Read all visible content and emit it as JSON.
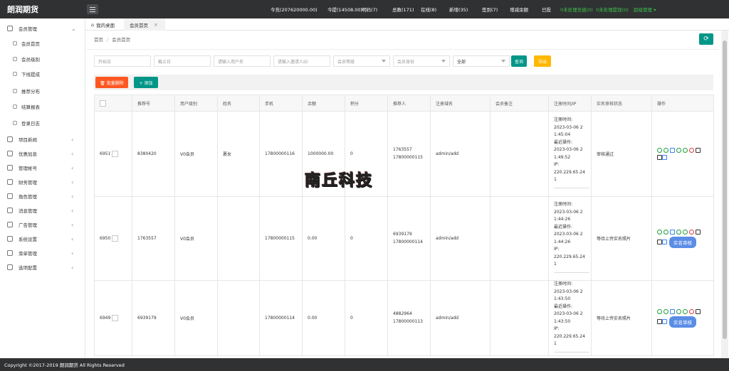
{
  "brand": "朗润期货",
  "topbar": {
    "stats": [
      {
        "label": "今充(207620000.00)",
        "color": "white"
      },
      {
        "label": "今提(14508.00)",
        "color": "white"
      },
      {
        "label": "明码(7)",
        "color": "white"
      },
      {
        "label": "总数(171)",
        "color": "white"
      },
      {
        "label": "在线(8)",
        "color": "white"
      },
      {
        "label": "新增(35)",
        "color": "white"
      },
      {
        "label": "签到(7)",
        "color": "white"
      },
      {
        "label": "增减余额",
        "color": "white"
      },
      {
        "label": "已投",
        "color": "white"
      },
      {
        "label": "0未处理充值(0)",
        "color": "green"
      },
      {
        "label": "0未处理提现(0)",
        "color": "green"
      },
      {
        "label": "超级管理 ▾",
        "color": "green"
      }
    ]
  },
  "sidebar": {
    "items": [
      {
        "label": "会员管理",
        "expanded": true
      },
      {
        "label": "会员首页",
        "sub": true
      },
      {
        "label": "会员级别",
        "sub": true
      },
      {
        "label": "下线提成",
        "sub": true
      },
      {
        "label": "推荐分布",
        "sub": true
      },
      {
        "label": "结算报表",
        "sub": true
      },
      {
        "label": "登录日志",
        "sub": true
      },
      {
        "label": "项目新闻"
      },
      {
        "label": "优惠加息"
      },
      {
        "label": "管理帐号"
      },
      {
        "label": "财务管理"
      },
      {
        "label": "角色管理"
      },
      {
        "label": "消息管理"
      },
      {
        "label": "广告管理"
      },
      {
        "label": "系统设置"
      },
      {
        "label": "菜单管理"
      },
      {
        "label": "选项配置"
      }
    ]
  },
  "tabs": [
    {
      "label": "我的桌面"
    },
    {
      "label": "会员首页",
      "close": "×"
    }
  ],
  "breadcrumb": {
    "home": "首页",
    "sep": "/",
    "current": "会员首页"
  },
  "filters": {
    "start_date": "开始日",
    "end_date": "截止日",
    "username": "请输入用户名",
    "inviter_id": "请输入邀请人ID",
    "level": "会员等级",
    "identity": "会员身份",
    "scope": "全部",
    "search": "查询",
    "export": "导出"
  },
  "toolbar": {
    "batch_delete": "🗑 批量删除",
    "add": "+ 添加"
  },
  "table": {
    "headers": [
      "",
      "推荐号",
      "用户级别",
      "姓名",
      "手机",
      "余额",
      "积分",
      "推荐人",
      "注册域名",
      "会员备注",
      "注册时间/IP",
      "实名审核状态",
      "操作"
    ],
    "rows": [
      {
        "id": "6951",
        "ref": "8380420",
        "level": "V0会员",
        "name": "裹女",
        "phone": "17800000116",
        "balance": "1000000.00",
        "points": "0",
        "referrer": [
          "1763557",
          "17800000115"
        ],
        "domain": "admin/add",
        "note": "",
        "reg": [
          "注册时间:",
          "2023-03-06 2",
          "1:45:04",
          "最近操作:",
          "2023-03-06 2",
          "1:49:52",
          "IP:",
          "220.229.65.24",
          "1"
        ],
        "status": "审核通过",
        "realname_btn": ""
      },
      {
        "id": "6950",
        "ref": "1763557",
        "level": "V0会员",
        "name": "",
        "phone": "17800000115",
        "balance": "0.00",
        "points": "0",
        "referrer": [
          "6939179",
          "17800000114"
        ],
        "domain": "admin/add",
        "note": "",
        "reg": [
          "注册时间:",
          "2023-03-06 2",
          "1:44:26",
          "最近操作:",
          "2023-03-06 2",
          "1:44:26",
          "IP:",
          "220.229.65.24",
          "1"
        ],
        "status": "等待上传实名照片",
        "realname_btn": "实名审核"
      },
      {
        "id": "6949",
        "ref": "6939179",
        "level": "V0会员",
        "name": "",
        "phone": "17800000114",
        "balance": "0.00",
        "points": "0",
        "referrer": [
          "4882964",
          "17800000113"
        ],
        "domain": "admin/add",
        "note": "",
        "reg": [
          "注册时间:",
          "2023-03-06 2",
          "1:43:50",
          "最近操作:",
          "2023-03-06 2",
          "1:43:50",
          "IP:",
          "220.229.65.24",
          "1"
        ],
        "status": "等待上传实名照片",
        "realname_btn": "实名审核"
      }
    ]
  },
  "watermark": "南丘科技",
  "footer": "Copyright ©2017-2019 朗润期货 All Rights Reserved",
  "colors": {
    "primary": "#009688",
    "danger": "#ff5722",
    "warning": "#ffb800",
    "topbar": "#2f3133",
    "red_text": "#e5383b"
  }
}
